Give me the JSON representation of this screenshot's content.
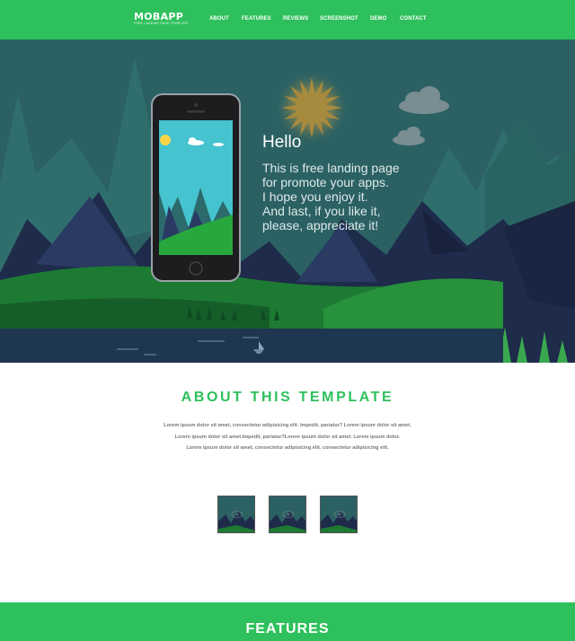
{
  "nav": {
    "logo_title": "MOBAPP",
    "logo_subtitle": "FREE LANDING PAGE TEMPLATE",
    "items": [
      {
        "label": "ABOUT"
      },
      {
        "label": "FEATURES"
      },
      {
        "label": "REVIEWS"
      },
      {
        "label": "SCREENSHOT"
      },
      {
        "label": "DEMO"
      },
      {
        "label": "CONTACT"
      }
    ]
  },
  "hero": {
    "title": "Hello",
    "lines": [
      "This is free landing page",
      "for promote your apps.",
      "I hope you enjoy it.",
      "And last, if you like it,",
      "please, appreciate it!"
    ]
  },
  "about": {
    "title": "ABOUT  THIS  TEMPLATE",
    "lines": [
      "Lorem ipsum dolor sit amet, consectetur adipisicing elit. Impedit, pariatur? Lorem ipsum dolor sit amet.",
      "Lorem ipsum dolor sit amet.Impedit, pariatur?Lorem ipsum dolor sit amet. Lorem ipsum dolor.",
      "Lorem ipsum dolor sit amet, consectetur adipisicing elit. consectetur adipisicing elit."
    ],
    "thumbnails": [
      {
        "icon": "eye-icon"
      },
      {
        "icon": "eye-icon"
      },
      {
        "icon": "eye-icon"
      }
    ]
  },
  "features": {
    "title": "FEATURES"
  },
  "colors": {
    "brand_green": "#2ec05c",
    "hero_teal": "#2b6163",
    "mountain_navy": "#1e2b4a"
  }
}
